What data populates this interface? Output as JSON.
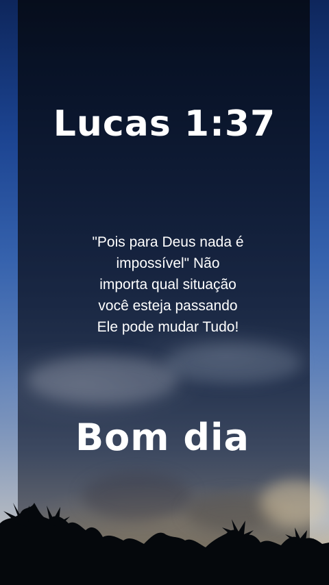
{
  "background": {
    "scene": "evening-sky-with-palm-trees",
    "colors": {
      "sky_top": "#07101f",
      "sky_mid": "#25395c",
      "horizon": "#b4a688",
      "side_strip": "#3a6bbd",
      "text": "#ffffff"
    }
  },
  "title": "Lucas 1:37",
  "quote": {
    "lines": [
      "\"Pois para Deus nada é",
      "impossível\" Não",
      "importa qual situação",
      "você esteja passando",
      "Ele pode mudar Tudo!"
    ]
  },
  "greeting": "Bom dia"
}
